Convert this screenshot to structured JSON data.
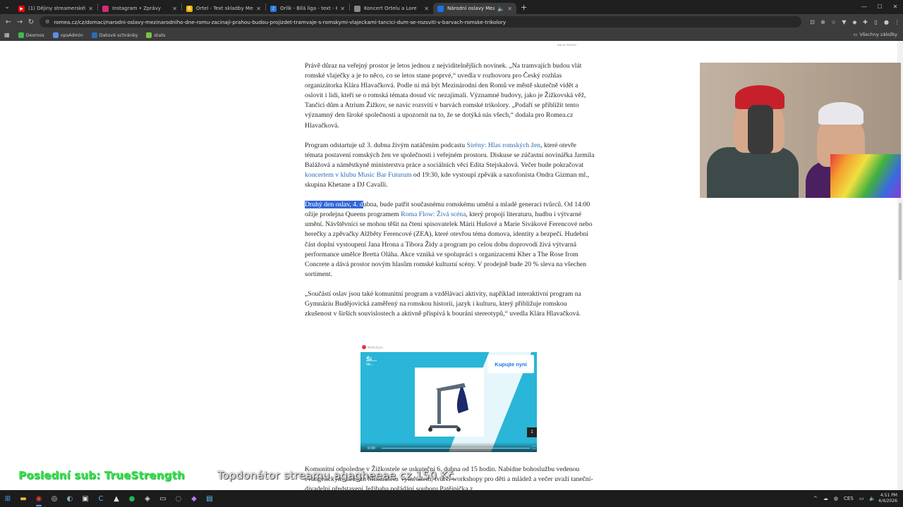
{
  "browser": {
    "tabs": [
      {
        "title": "(1) Dějiny streamerského národa",
        "icon": "youtube-icon",
        "color": "#ff0000"
      },
      {
        "title": "Instagram • Zprávy",
        "icon": "instagram-icon",
        "color": "#d62976"
      },
      {
        "title": "Ortel - Text skladby Mešita z alb",
        "icon": "bandzone-icon",
        "color": "#f0b400"
      },
      {
        "title": "Orlík - Bílá liga - text - Karaoke",
        "icon": "karaoke-icon",
        "color": "#2a7ae2"
      },
      {
        "title": "Koncert Ortelu a Lore",
        "icon": "page-icon",
        "color": "#888888"
      },
      {
        "title": "Národní oslavy Mezinárodní",
        "icon": "romea-icon",
        "color": "#1a73e8",
        "active": true
      }
    ],
    "url": "romea.cz/cz/domaci/narodni-oslavy-mezinarodniho-dne-romu-zacinaji-prahou-budou-projizdet-tramvaje-s-romskymi-vlajeckami-tancici-dum-se-rozsviti-v-barvach-romske-trikolory",
    "bookmarks": [
      {
        "label": "Desmos",
        "color": "#3dba4e"
      },
      {
        "label": "vpsAdmin",
        "color": "#5b8def"
      },
      {
        "label": "Datové schránky",
        "color": "#2a6ebb"
      },
      {
        "label": "stats",
        "color": "#7cc242"
      }
    ],
    "bookmarks_all": "Všechny záložky"
  },
  "article": {
    "ad_label": "Ads by TeleChill",
    "p1": "Právě důraz na veřejný prostor je letos jednou z nejviditelnějších novinek. „Na tramvajích budou vlát romské vlaječky a je to něco, co se letos stane poprvé,“ uvedla v rozhovoru pro Český rozhlas organizátorka Klára Hlavačková. Podle ní má být Mezinárodní den Romů ve městě skutečně vidět a oslovit i lidi, kteří se o romská témata dosud víc nezajímali. Významné budovy, jako je Žižkovská věž, Tančící dům a Atrium Žižkov, se navíc rozsvítí v barvách romské trikolory. „Podaří se přiblížit tento významný den široké společnosti a upozornit na to, že se dotýká nás všech,“ dodala pro Romea.cz Hlavačková.",
    "p2_a": "Program odstartuje už 3. dubna živým natáčením podcastu ",
    "p2_link1": "Sirény: Hlas romských žen",
    "p2_b": ", které otevře témata postavení romských žen ve společnosti i veřejném prostoru. Diskuse se zúčastní novinářka Jarmila Balážová a náměstkyně ministerstva práce a sociálních věcí Edita Stejskalová. Večer bude pokračovat ",
    "p2_link2": "koncertem v klubu Music Bar Futurum",
    "p2_c": " od 19:30, kde vystoupí zpěvák a saxofonista Ondra Gizman ml., skupina Khetane a DJ Cavalli.",
    "p3_sel": "Druhý den oslav, 4. d",
    "p3_a": "ubna, bude patřit současnému romskému umění a mladé generaci tvůrců. Od 14:00 ožije prodejna Queens programem ",
    "p3_link": "Roma Flow: Živá scéna",
    "p3_b": ", který propojí literaturu, hudbu i výtvarné umění. Návštěvníci se mohou těšit na čtení spisovatelek Márii Hušové a Marie Sivákové Ferencové nebo herečky a zpěvačky Alžběty Ferencové (ZEA), které otevřou téma domova, identity a bezpečí. Hudební část doplní vystoupení Jana Hrona a Tibora Židy a program po celou dobu doprovodí živá výtvarná performance umělce Bretta Oláha. Akce vzniká ve spolupráci s organizacemi Kher a The Rose from Concrete a dává prostor novým hlasům romské kulturní scény. V prodejně bude 20 % sleva na všechen sortiment.",
    "p4": "„Součástí oslav jsou také komunitní program a vzdělávací aktivity, například interaktivní program na Gymnáziu Budějovická zaměřený na romskou historii, jazyk i kulturu, který přibližuje romskou zkušenost v širších souvislostech a aktivně přispívá k bourání stereotypů,“ uvedla Klára Hlavačková.",
    "p5": "Komunitní odpoledne v Žižkostele se uskuteční 6. dubna od 15 hodin. Nabídne bohoslužbu vedenou evangelickým farářem Mikulášem Vymětalem, tvůrčí workshopy pro děti a mládež a večer uvaží taneční-divadelní představení Ježibaba pořádání souboru Patějnička z"
  },
  "video_ad": {
    "source": "Medichyne",
    "title": "Ši...",
    "subtitle": "htt...",
    "cta": "Kupujte nyní",
    "badge": "1",
    "time": "0:09"
  },
  "stream_overlay": {
    "last_sub": "Poslední sub: TrueStrength",
    "top_donor": "Topdonátor streamu agagheeae cz 150 Kč"
  },
  "taskbar": {
    "language": "CES",
    "time": "4:51 PM",
    "date": "4/4/2026"
  }
}
